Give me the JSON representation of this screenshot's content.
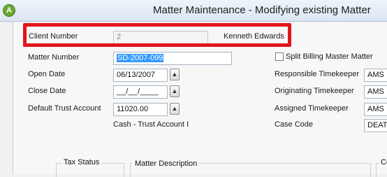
{
  "window": {
    "title": "Matter Maintenance - Modifying existing Matter",
    "logo_glyph": "A"
  },
  "client": {
    "label": "Client Number",
    "value": "2",
    "name": "Kenneth Edwards"
  },
  "matter_number": {
    "label": "Matter Number",
    "value": "SD-2007-099"
  },
  "open_date": {
    "label": "Open Date",
    "value": "06/13/2007"
  },
  "close_date": {
    "label": "Close Date",
    "value": "__/__/____"
  },
  "trust_account": {
    "label": "Default Trust Account",
    "value": "11020.00",
    "description": "Cash - Trust Account I"
  },
  "split_billing": {
    "label": "Split Billing Master Matter",
    "checked": false
  },
  "responsible": {
    "label": "Responsible Timekeeper",
    "value": "AMS"
  },
  "originating": {
    "label": "Originating Timekeeper",
    "value": "AMS"
  },
  "assigned": {
    "label": "Assigned Timekeeper",
    "value": "AMS"
  },
  "case_code": {
    "label": "Case Code",
    "value": "DEATH"
  },
  "groups": {
    "tax_status": "Tax Status",
    "matter_description": "Matter Description",
    "third_fragment": "Co"
  },
  "colors": {
    "highlight": "#e2141c",
    "selection": "#3399ff",
    "logo": "#6aa832"
  },
  "icons": {
    "lookup": "caret-up-icon"
  }
}
